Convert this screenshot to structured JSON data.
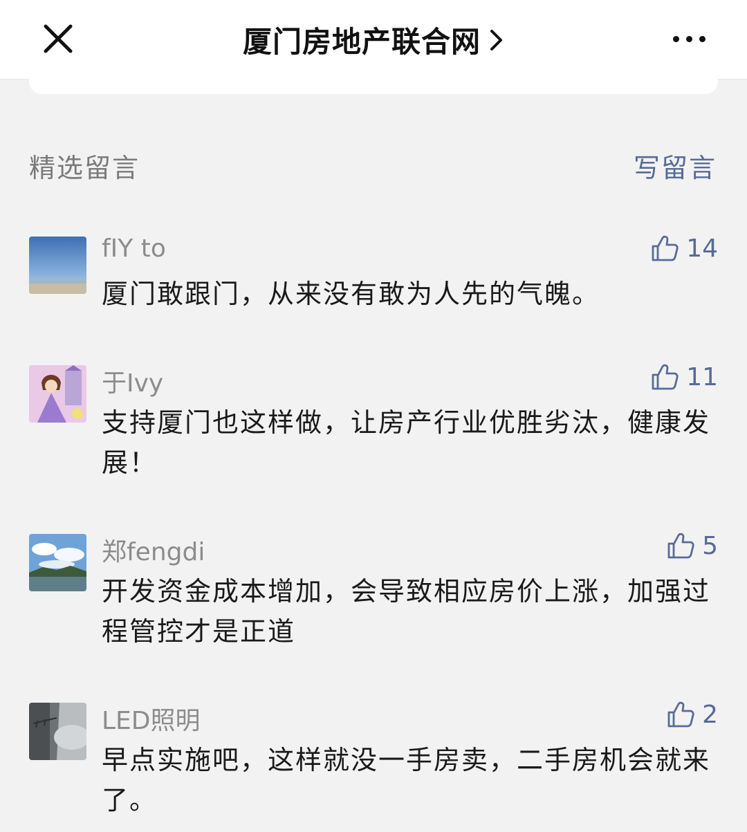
{
  "header": {
    "title": "厦门房地产联合网",
    "close_icon": "close-icon",
    "more_icon": "more-dots-icon",
    "chevron_icon": "chevron-right-icon"
  },
  "comments_section": {
    "title": "精选留言",
    "write_label": "写留言",
    "accent_color": "#576b95"
  },
  "comments": [
    {
      "nickname": "fIY to",
      "likes": "14",
      "text": "厦门敢跟门，从来没有敢为人先的气魄。"
    },
    {
      "nickname": "于Ivy",
      "likes": "11",
      "text": "支持厦门也这样做，让房产行业优胜劣汰，健康发展！"
    },
    {
      "nickname": "郑fengdi",
      "likes": "5",
      "text": "开发资金成本增加，会导致相应房价上涨，加强过程管控才是正道"
    },
    {
      "nickname": "LED照明",
      "likes": "2",
      "text": "早点实施吧，这样就没一手房卖，二手房机会就来了。"
    }
  ]
}
